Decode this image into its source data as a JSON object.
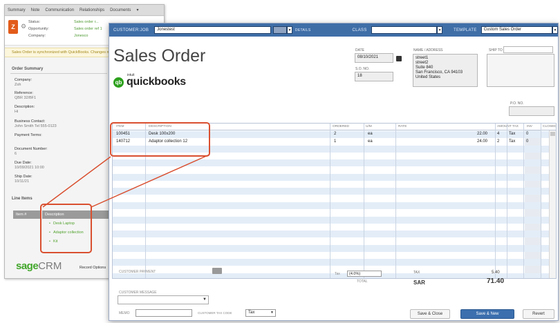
{
  "crm": {
    "menu": [
      "Summary",
      "Note",
      "Communication",
      "Relationships",
      "Documents",
      "▾"
    ],
    "logo_letter": "Z",
    "header_fields": [
      {
        "label": "Status:",
        "value": "Sales order r..."
      },
      {
        "label": "Opportunity:",
        "value": "Sales order ref 1"
      },
      {
        "label": "Company:",
        "value": "Jonesco"
      }
    ],
    "warning": "Sales Order is synchronized with QuickBooks. Changes made here...",
    "summary_title": "Order Summary",
    "summary": [
      {
        "label": "Company:",
        "value": "Zoh"
      },
      {
        "label": "Reference:",
        "value": "QBR 32/BF1"
      },
      {
        "label": "Description:",
        "value": "Hi"
      },
      {
        "label": "Business Contact:",
        "value": "John Smith  Tel 555-0123"
      },
      {
        "label": "Payment Terms:",
        "value": ""
      },
      {
        "label": "Document Number:",
        "value": "6"
      },
      {
        "label": "Due Date:",
        "value": "10/09/2021 10:00"
      },
      {
        "label": "Ship Date:",
        "value": "10/11/21"
      }
    ],
    "order_items_title": "Line Items",
    "items_table": {
      "col1": "Item #",
      "col2": "Description",
      "rows": [
        "Desk Laptop",
        "Adaptor collection",
        "Kit"
      ]
    },
    "logo_sage": "sage",
    "logo_crm": "CRM",
    "footer_link": "Record Options"
  },
  "qb": {
    "toolbar": {
      "customer_label": "CUSTOMER:JOB",
      "customer_value": "Jonestest",
      "class_label": "CLASS",
      "template_label": "TEMPLATE",
      "template_value": "Custom Sales Order"
    },
    "title": "Sales Order",
    "logo_intuit": "intuit",
    "logo_word": "quickbooks",
    "date_label": "DATE",
    "date_value": "08/10/2021",
    "so_label": "S.O. NO.",
    "so_value": "18",
    "name_address_label": "NAME / ADDRESS",
    "name_address_lines": [
      "street1",
      "street2",
      "Suite 840",
      "San Francisco, CA 94103",
      "United States"
    ],
    "ship_to_label": "SHIP TO",
    "po_label": "P.O. NO.",
    "grid_headers": [
      "ITEM",
      "DESCRIPTION",
      "ORDERED",
      "U/M",
      "RATE",
      "AMOUNT",
      "TAX",
      "INV",
      "CLOSED"
    ],
    "grid_rows": [
      {
        "item": "100451",
        "description": "Desk 100x200",
        "ordered": "2",
        "um": "ea",
        "rate": "",
        "amount": "22.00",
        "count": "4",
        "tax": "Tax",
        "inv": "0"
      },
      {
        "item": "140712",
        "description": "Adaptor collection 12",
        "ordered": "1",
        "um": "ea",
        "rate": "",
        "amount": "24.00",
        "count": "2",
        "tax": "Tax",
        "inv": "0"
      }
    ],
    "bottom": {
      "discount_label": "CUSTOMER MESSAGE",
      "tax_label": "TAX",
      "tax_rate_text": "(4.0%)",
      "tax_rate_prefix": "Tax",
      "total_caption": "TOTAL",
      "total_currency": "SAR",
      "tax_value": "5.40",
      "total_value": "71.40",
      "customer_message_label": "CUSTOMER MESSAGE",
      "memo_label": "MEMO",
      "tax_code_label": "CUSTOMER TAX CODE",
      "tax_code_value": "Tax",
      "buttons": {
        "close": "Save & Close",
        "save_new": "Save & New",
        "revert": "Revert"
      }
    }
  }
}
